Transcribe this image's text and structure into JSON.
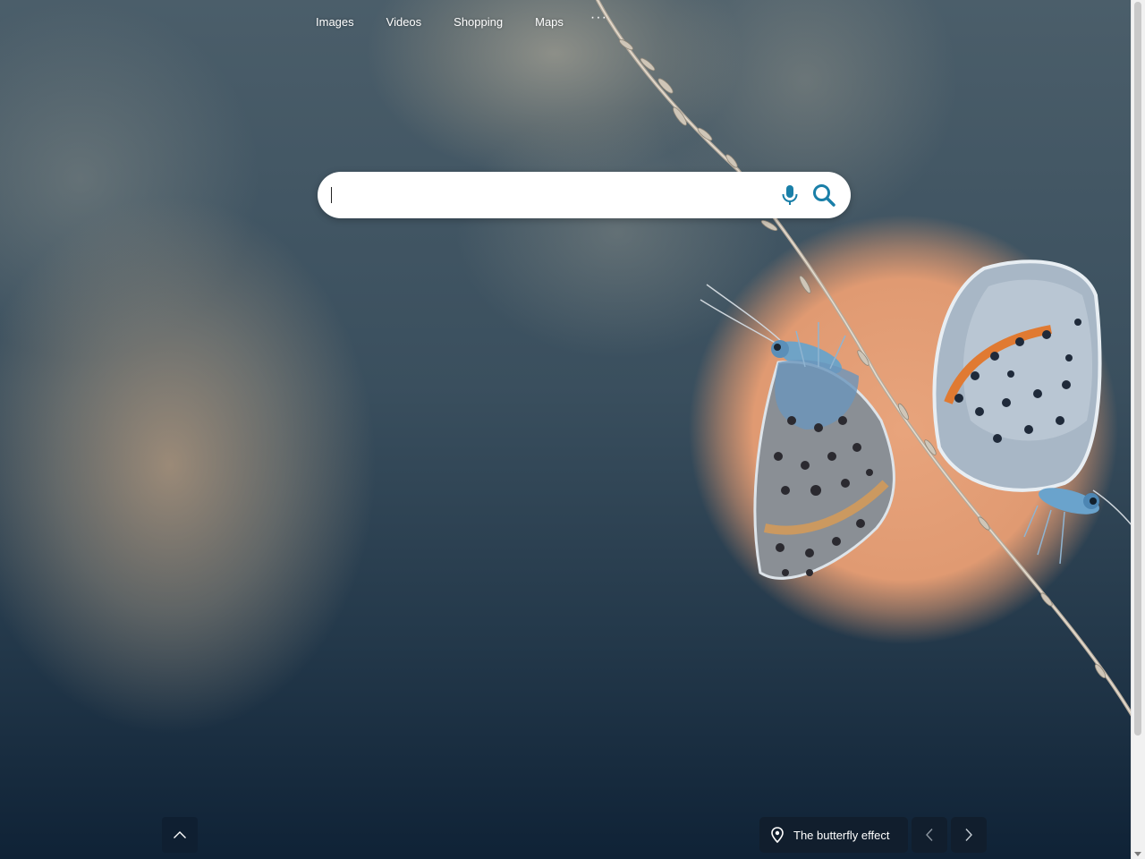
{
  "nav": {
    "links": [
      "Images",
      "Videos",
      "Shopping",
      "Maps"
    ],
    "more_label": "···"
  },
  "search": {
    "value": "",
    "placeholder": ""
  },
  "image_caption": {
    "title": "The butterfly effect"
  },
  "colors": {
    "accent": "#1a7fa8",
    "sun": "#e8a47c"
  },
  "icons": [
    "microphone-icon",
    "search-icon",
    "location-pin-icon",
    "chevron-up-icon",
    "chevron-left-icon",
    "chevron-right-icon"
  ]
}
